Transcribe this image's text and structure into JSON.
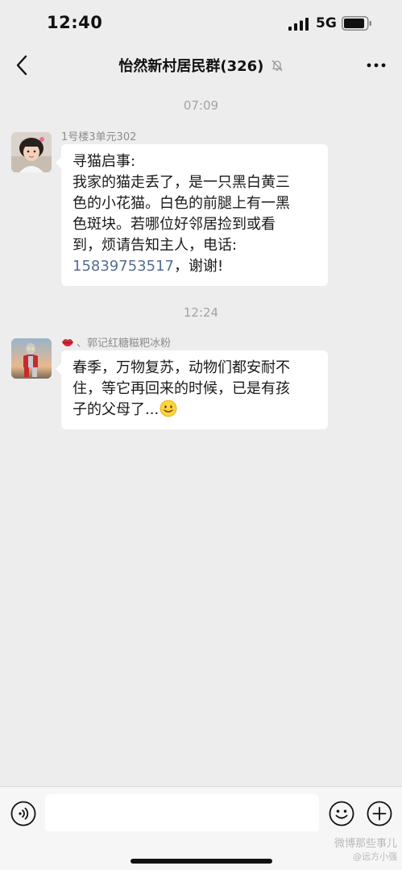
{
  "status_bar": {
    "time": "12:40",
    "network": "5G",
    "signal_icon": "signal-bars-icon",
    "battery_icon": "battery-icon"
  },
  "nav": {
    "back_icon": "chevron-left-icon",
    "title": "怡然新村居民群(326)",
    "mute_icon": "bell-muted-icon",
    "more_icon": "more-dots-icon"
  },
  "messages": [
    {
      "timestamp": "07:09",
      "sender": "1号楼3单元302",
      "text_lines": [
        "寻猫启事:",
        "我家的猫走丢了，是一只黑白黄三",
        "色的小花猫。白色的前腿上有一黑",
        "色斑块。若哪位好邻居捡到或看",
        "到，烦请告知主人，电话:"
      ],
      "phone": "15839753517",
      "tail_text": "，谢谢!"
    },
    {
      "timestamp": "12:24",
      "sender_prefix_icon": "lips-emoji-icon",
      "sender": "、郭记红糖糍粑冰粉",
      "text_lines": [
        "春季，万物复苏，动物们都安耐不",
        "住，等它再回来的时候，已是有孩",
        "子的父母了..."
      ],
      "trailing_emoji": "smile-emoji-icon"
    }
  ],
  "input_bar": {
    "voice_icon": "voice-icon",
    "input_value": "",
    "emoji_icon": "emoji-icon",
    "plus_icon": "plus-circle-icon"
  },
  "watermark": {
    "line1": "微博那些事儿",
    "line2": "@远方小强"
  },
  "colors": {
    "background": "#ededed",
    "bubble": "#ffffff",
    "link": "#576b95",
    "timestamp": "#a3a3a3"
  }
}
